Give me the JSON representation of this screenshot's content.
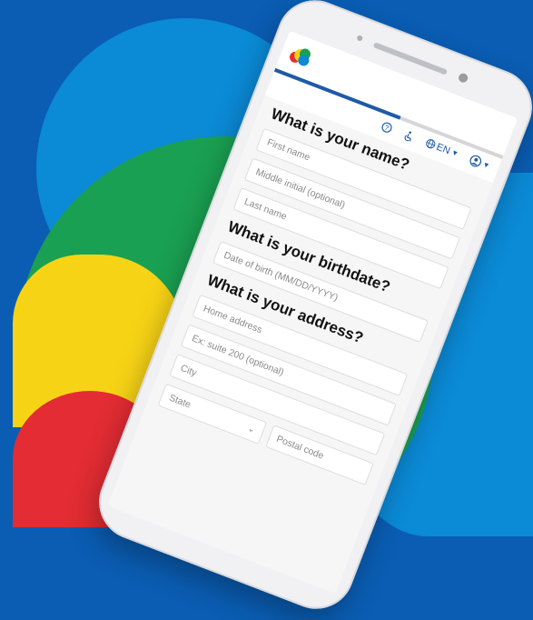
{
  "progress": 0.55,
  "header": {
    "help_icon": "help-circle-icon",
    "accessibility_icon": "accessibility-icon",
    "language": "EN",
    "profile_icon": "user-circle-icon"
  },
  "sections": {
    "name": {
      "heading": "What is your name?",
      "first_name": "First name",
      "middle_initial": "Middle initial (optional)",
      "last_name": "Last name"
    },
    "birthdate": {
      "heading": "What is your birthdate?",
      "dob": "Date of birth (MM/DD/YYYY)"
    },
    "address": {
      "heading": "What is your address?",
      "home": "Home address",
      "suite": "Ex: suite 200 (optional)",
      "city": "City",
      "state": "State",
      "postal": "Postal code"
    }
  },
  "colors": {
    "background": "#0a5db3",
    "light_blue": "#0b8ad6",
    "green": "#1aa052",
    "yellow": "#f7d316",
    "red": "#e32c33",
    "primary": "#1f5aa6"
  }
}
